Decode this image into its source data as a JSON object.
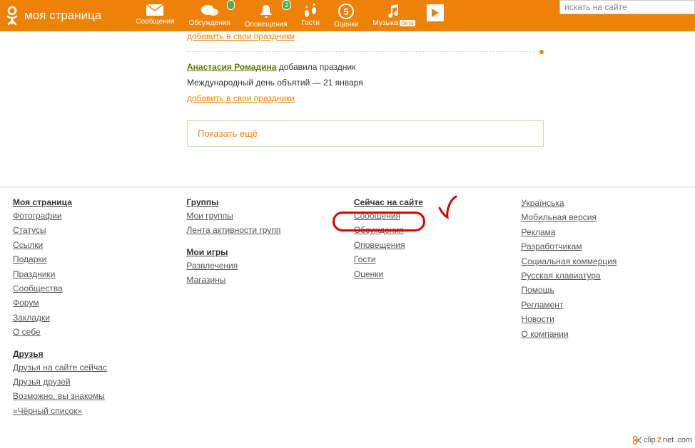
{
  "header": {
    "title": "моя страница",
    "nav": {
      "messages": "Сообщения",
      "discussions": "Обсуждения",
      "notifications": "Оповещения",
      "notif_badge": "2",
      "guests": "Гости",
      "ratings": "Оценки",
      "music": "Музыка",
      "beta": "бета"
    },
    "search_placeholder": "искать на сайте"
  },
  "feed": {
    "add_link_top": "добавить в свои праздники",
    "author": "Анастасия Ромадина",
    "action": "добавила праздник",
    "body": "Международный день объятий — 21 января",
    "add_link": "добавить в свои праздники",
    "show_more": "Показать ещё"
  },
  "footer": {
    "col1_heading": "Моя страница",
    "col1": [
      "Фотографии",
      "Статусы",
      "Ссылки",
      "Подарки",
      "Праздники",
      "Сообщества",
      "Форум",
      "Закладки",
      "О себе"
    ],
    "col1_heading2": "Друзья",
    "col1b": [
      "Друзья на сайте сейчас",
      "Друзья друзей",
      "Возможно, вы знакомы",
      "«Чёрный список»"
    ],
    "col2_heading": "Группы",
    "col2": [
      "Мои группы",
      "Лента активности групп"
    ],
    "col2_heading2": "Мои игры",
    "col2b": [
      "Развлечения",
      "Магазины"
    ],
    "col3_heading": "Сейчас на сайте",
    "col3": [
      "Сообщения",
      "Обсуждения",
      "Оповещения",
      "Гости",
      "Оценки"
    ],
    "col4": [
      "Українська",
      "Мобильная версия",
      "Реклама",
      "Разработчикам",
      "Социальная коммерция",
      "Русская клавиатура",
      "Помощь",
      "Регламент",
      "Новости",
      "О компании"
    ]
  },
  "watermark": {
    "a": "clip",
    "b": "2",
    "c": "net",
    "d": ".com"
  }
}
